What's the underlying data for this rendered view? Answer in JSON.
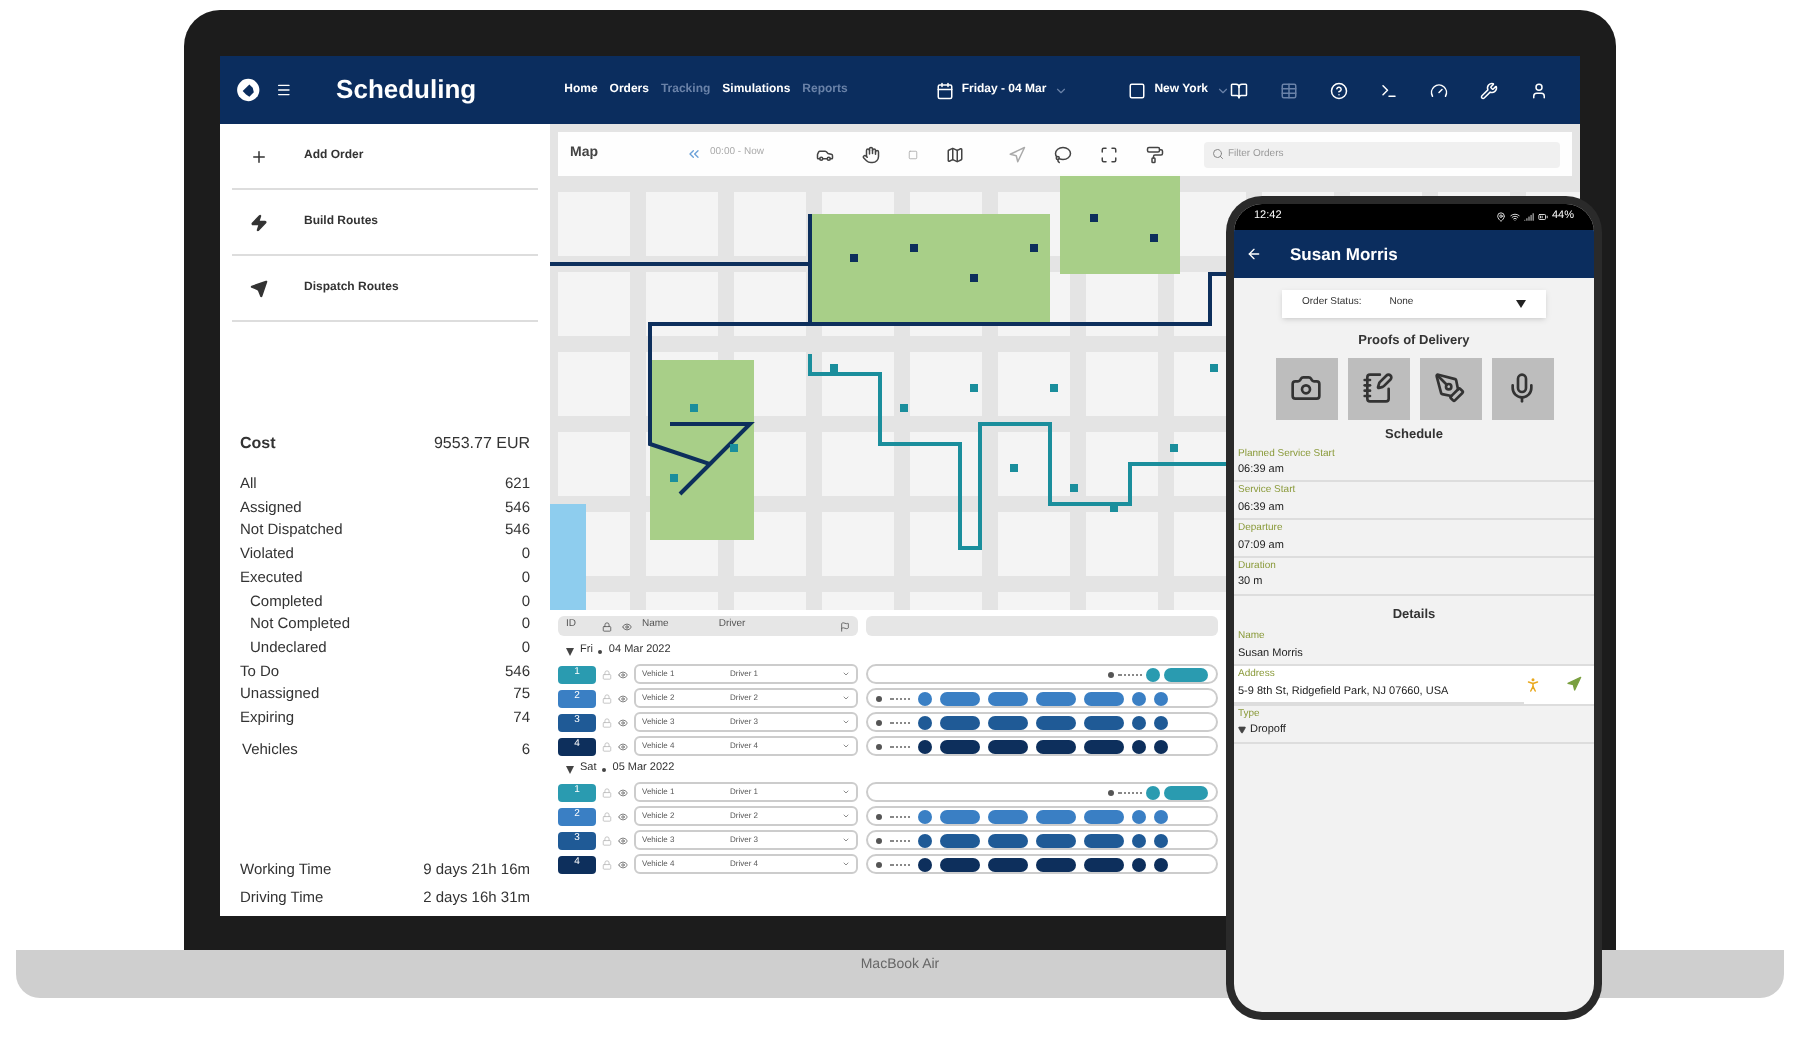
{
  "app": {
    "title": "Scheduling",
    "nav": [
      {
        "label": "Home",
        "disabled": false
      },
      {
        "label": "Orders",
        "disabled": false
      },
      {
        "label": "Tracking",
        "disabled": true
      },
      {
        "label": "Simulations",
        "disabled": false
      },
      {
        "label": "Reports",
        "disabled": true
      }
    ],
    "date": "Friday - 04 Mar",
    "region": "New York"
  },
  "sidebar": {
    "actions": [
      {
        "kind": "add",
        "label": "Add Order"
      },
      {
        "kind": "build",
        "label": "Build Routes"
      },
      {
        "kind": "dispatch",
        "label": "Dispatch Routes"
      }
    ],
    "cost": {
      "label": "Cost",
      "value": "9553.77 EUR"
    },
    "stats": [
      {
        "label": "All",
        "value": "621"
      },
      {
        "label": "Assigned",
        "value": "546"
      },
      {
        "label": "Not Dispatched",
        "value": "546"
      },
      {
        "label": "Violated",
        "value": "0"
      },
      {
        "label": "Executed",
        "value": "0",
        "children": [
          {
            "label": "Completed",
            "value": "0"
          },
          {
            "label": "Not Completed",
            "value": "0"
          },
          {
            "label": "Undeclared",
            "value": "0"
          }
        ]
      },
      {
        "label": "To Do",
        "value": "546"
      },
      {
        "label": "Unassigned",
        "value": "75"
      },
      {
        "label": "Expiring",
        "value": "74"
      }
    ],
    "vehicles": {
      "label": "Vehicles",
      "value": "6"
    },
    "times": [
      {
        "label": "Working Time",
        "value": "9 days 21h 16m"
      },
      {
        "label": "Driving Time",
        "value": "2 days 16h 31m"
      }
    ]
  },
  "map": {
    "title": "Map",
    "time_range": "00:00 - Now",
    "filter": {
      "placeholder": "Filter Orders"
    }
  },
  "table": {
    "columns": [
      "ID",
      "Name",
      "Driver"
    ],
    "groups": [
      {
        "label": "Fri",
        "date": "04 Mar 2022",
        "expanded": true,
        "rows": [
          {
            "id": "1",
            "name": "Vehicle 1",
            "driver": "Driver 1",
            "color": "#2a9bb0",
            "kind": "short"
          },
          {
            "id": "2",
            "name": "Vehicle 2",
            "driver": "Driver 2",
            "color": "#3a7fc4",
            "kind": "full"
          },
          {
            "id": "3",
            "name": "Vehicle 3",
            "driver": "Driver 3",
            "color": "#1f5a96",
            "kind": "full"
          },
          {
            "id": "4",
            "name": "Vehicle 4",
            "driver": "Driver 4",
            "color": "#0d2f5c",
            "kind": "full"
          }
        ]
      },
      {
        "label": "Sat",
        "date": "05 Mar 2022",
        "expanded": true,
        "rows": [
          {
            "id": "1",
            "name": "Vehicle 1",
            "driver": "Driver 1",
            "color": "#2a9bb0",
            "kind": "short"
          },
          {
            "id": "2",
            "name": "Vehicle 2",
            "driver": "Driver 2",
            "color": "#3a7fc4",
            "kind": "full"
          },
          {
            "id": "3",
            "name": "Vehicle 3",
            "driver": "Driver 3",
            "color": "#1f5a96",
            "kind": "full"
          },
          {
            "id": "4",
            "name": "Vehicle 4",
            "driver": "Driver 4",
            "color": "#0d2f5c",
            "kind": "full"
          }
        ]
      }
    ]
  },
  "laptop": {
    "model": "MacBook Air"
  },
  "phone": {
    "time": "12:42",
    "battery": "44%",
    "title": "Susan Morris",
    "status": {
      "label": "Order Status:",
      "value": "None"
    },
    "proofs_title": "Proofs of Delivery",
    "proofs": [
      {
        "kind": "photo"
      },
      {
        "kind": "note"
      },
      {
        "kind": "signature"
      },
      {
        "kind": "voice"
      }
    ],
    "schedule_title": "Schedule",
    "schedule": [
      {
        "label": "Planned Service Start",
        "value": "06:39 am"
      },
      {
        "label": "Service Start",
        "value": "06:39 am"
      },
      {
        "label": "Departure",
        "value": "07:09 am"
      },
      {
        "label": "Duration",
        "value": "30 m"
      }
    ],
    "details_title": "Details",
    "details": [
      {
        "kind": "text",
        "label": "Name",
        "value": "Susan Morris"
      },
      {
        "kind": "address",
        "label": "Address",
        "value": "5-9 8th St, Ridgefield Park, NJ 07660, USA"
      },
      {
        "kind": "type",
        "label": "Type",
        "value": "Dropoff"
      }
    ]
  }
}
